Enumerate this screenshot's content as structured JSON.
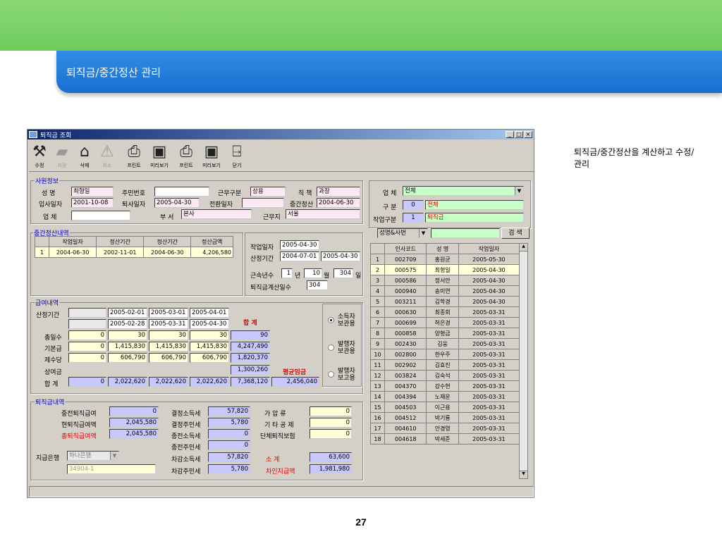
{
  "slide": {
    "title": "퇴직금/중간정산 관리",
    "note": "퇴직금/중간정산을 계산하고 수정/관리",
    "page": "27"
  },
  "window": {
    "title": "퇴직금 조회",
    "min": "_",
    "max": "□",
    "close": "×"
  },
  "toolbar": [
    "수정",
    "저장",
    "삭제",
    "취소",
    "프린트",
    "미리보기",
    "프린트",
    "미리보기",
    "닫기"
  ],
  "employee": {
    "group": "사원정보",
    "name_label": "성 명",
    "name": "최형일",
    "jumin_label": "주민번호",
    "jumin": "",
    "worktype_label": "근무구분",
    "worktype": "상용",
    "position_label": "직 책",
    "position": "과장",
    "join_label": "입사일자",
    "join": "2001-10-08",
    "leave_label": "퇴사일자",
    "leave": "2005-04-30",
    "transfer_label": "전환일자",
    "transfer": "",
    "mid_label": "중간정산",
    "mid": "2004-06-30",
    "company_label": "업 체",
    "company": "",
    "dept_label": "부 서",
    "dept": "본사",
    "site_label": "근무지",
    "site": "서울"
  },
  "midsettle": {
    "group": "중간정산내역",
    "headers": [
      "작업일자",
      "정산기간",
      "정산기간",
      "정산금액"
    ],
    "rows": [
      [
        "1",
        "2004-06-30",
        "2002-11-01",
        "2004-06-30",
        "4,206,580"
      ]
    ]
  },
  "calc": {
    "work_label": "작업일자",
    "work": "2005-04-30",
    "period_label": "산정기간",
    "from": "2004-07-01",
    "to": "2005-04-30",
    "years_label": "근속년수",
    "years": "1",
    "y_unit": "년",
    "months": "10",
    "m_unit": "월",
    "days": "304",
    "d_unit": "일",
    "calcdays_label": "퇴직금계산일수",
    "calcdays": "304"
  },
  "pay": {
    "group": "급여내역",
    "period_label": "산정기간",
    "from": [
      "2005-02-01",
      "2005-03-01",
      "2005-04-01"
    ],
    "to": [
      "2005-02-28",
      "2005-03-31",
      "2005-04-30"
    ],
    "total_label": "합 계",
    "days_label": "총일수",
    "days": [
      "0",
      "30",
      "30",
      "30",
      "90"
    ],
    "base_label": "기본급",
    "base": [
      "0",
      "1,415,830",
      "1,415,830",
      "1,415,830",
      "4,247,490"
    ],
    "allow_label": "제수당",
    "allow": [
      "0",
      "606,790",
      "606,790",
      "606,790",
      "1,820,370"
    ],
    "bonus_label": "상여금",
    "bonus": "1,300,260",
    "avg_label": "평균임금",
    "sum_label": "합 계",
    "sum": [
      "0",
      "2,022,620",
      "2,022,620",
      "2,022,620",
      "7,368,120"
    ],
    "avg": "2,456,040",
    "radio": [
      "소득자 보관용",
      "발행자 보관용",
      "발행자 보고용"
    ]
  },
  "retire": {
    "group": "퇴직금내역",
    "a_label": "중전퇴직급여",
    "a": "0",
    "b_label": "현퇴직급여액",
    "b": "2,045,580",
    "c_label": "총퇴직급여액",
    "c": "2,045,580",
    "d_label": "결정소득세",
    "d": "57,820",
    "e_label": "결정주민세",
    "e": "5,780",
    "f_label": "종전소득세",
    "f": "0",
    "g_label": "종전주민세",
    "g": "0",
    "h_label": "차감소득세",
    "h": "57,820",
    "i_label": "차감주민세",
    "i": "5,780",
    "j_label": "가 압 류",
    "j": "0",
    "k_label": "기 타 공 제",
    "k": "0",
    "l_label": "단체퇴직보험",
    "l": "0",
    "m_label": "소 계",
    "m": "63,600",
    "n_label": "차인지급액",
    "n": "1,981,980",
    "bank_label": "지급은행",
    "bank": "하나은행",
    "acct": "34904-1"
  },
  "search": {
    "company_label": "업 체",
    "company": "전체",
    "type_label": "구 분",
    "type_code": "0",
    "type": "전체",
    "work_label": "작업구분",
    "work_code": "1",
    "work": "퇴직금",
    "mode": "성명&사번",
    "btn": "검 색",
    "headers": [
      "인사코드",
      "성 명",
      "작업일자"
    ],
    "rows": [
      [
        "1",
        "002709",
        "홍원균",
        "2005-05-30"
      ],
      [
        "2",
        "000575",
        "최형일",
        "2005-04-30"
      ],
      [
        "3",
        "000586",
        "정서안",
        "2005-04-30"
      ],
      [
        "4",
        "000940",
        "송미연",
        "2005-04-30"
      ],
      [
        "5",
        "003211",
        "김학경",
        "2005-04-30"
      ],
      [
        "6",
        "000630",
        "최종회",
        "2005-03-31"
      ],
      [
        "7",
        "000699",
        "허은경",
        "2005-03-31"
      ],
      [
        "8",
        "000858",
        "양형금",
        "2005-03-31"
      ],
      [
        "9",
        "002430",
        "김웅",
        "2005-03-31"
      ],
      [
        "10",
        "002800",
        "한우주",
        "2005-03-31"
      ],
      [
        "11",
        "002902",
        "김효진",
        "2005-03-31"
      ],
      [
        "12",
        "003824",
        "김숙석",
        "2005-03-31"
      ],
      [
        "13",
        "004370",
        "강수현",
        "2005-03-31"
      ],
      [
        "14",
        "004394",
        "노재운",
        "2005-03-31"
      ],
      [
        "15",
        "004503",
        "이근용",
        "2005-03-31"
      ],
      [
        "16",
        "004512",
        "박기룡",
        "2005-03-31"
      ],
      [
        "17",
        "004610",
        "안경영",
        "2005-03-31"
      ],
      [
        "18",
        "004618",
        "박세준",
        "2005-03-31"
      ]
    ]
  }
}
